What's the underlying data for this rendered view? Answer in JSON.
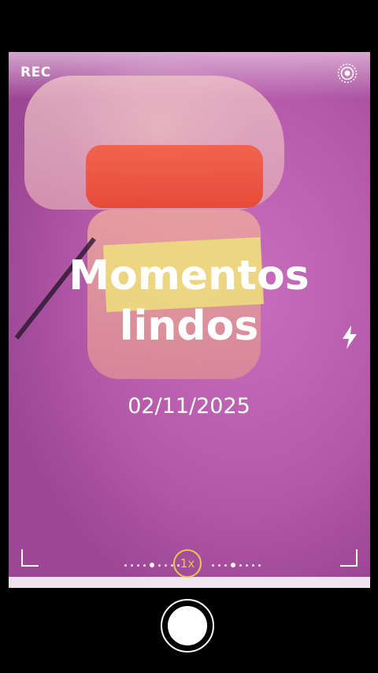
{
  "camera": {
    "rec_label": "REC",
    "zoom_label": "1x",
    "mode_icon": "live-photo-icon",
    "flash_icon": "flash-icon",
    "accent_color": "#e8c84a"
  },
  "overlay": {
    "title": "Momentos lindos",
    "date": "02/11/2025"
  }
}
